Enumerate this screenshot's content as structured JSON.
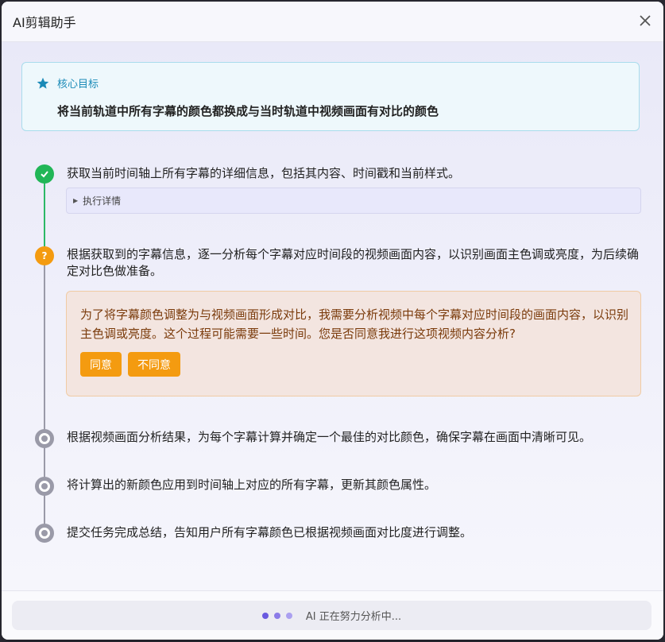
{
  "window": {
    "title": "AI剪辑助手"
  },
  "goal": {
    "label": "核心目标",
    "text": "将当前轨道中所有字幕的颜色都换成与当时轨道中视频画面有对比的颜色"
  },
  "steps": [
    {
      "status": "done",
      "text": "获取当前时间轴上所有字幕的详细信息，包括其内容、时间戳和当前样式。",
      "details_label": "执行详情"
    },
    {
      "status": "awaiting",
      "text": "根据获取到的字幕信息，逐一分析每个字幕对应时间段的视频画面内容，以识别画面主色调或亮度，为后续确定对比色做准备。",
      "confirm": {
        "text": "为了将字幕颜色调整为与视频画面形成对比，我需要分析视频中每个字幕对应时间段的画面内容，以识别主色调或亮度。这个过程可能需要一些时间。您是否同意我进行这项视频内容分析?",
        "agree_label": "同意",
        "disagree_label": "不同意"
      }
    },
    {
      "status": "pending",
      "text": "根据视频画面分析结果，为每个字幕计算并确定一个最佳的对比颜色，确保字幕在画面中清晰可见。"
    },
    {
      "status": "pending",
      "text": "将计算出的新颜色应用到时间轴上对应的所有字幕，更新其颜色属性。"
    },
    {
      "status": "pending",
      "text": "提交任务完成总结，告知用户所有字幕颜色已根据视频画面对比度进行调整。"
    }
  ],
  "footer": {
    "status_text": "AI 正在努力分析中..."
  },
  "icons": {
    "close": "close-icon",
    "goal": "star-icon",
    "done": "check-icon",
    "awaiting": "question-icon",
    "details": "triangle-right-icon"
  },
  "colors": {
    "accent_blue": "#1a8ab7",
    "success_green": "#21b657",
    "warning_orange": "#f49b10",
    "pending_gray": "#9a9aa8",
    "confirm_text": "#7a3a0a",
    "loading_dot_1": "#6a5ae0",
    "loading_dot_2": "#8b7be8",
    "loading_dot_3": "#aba0f0"
  }
}
